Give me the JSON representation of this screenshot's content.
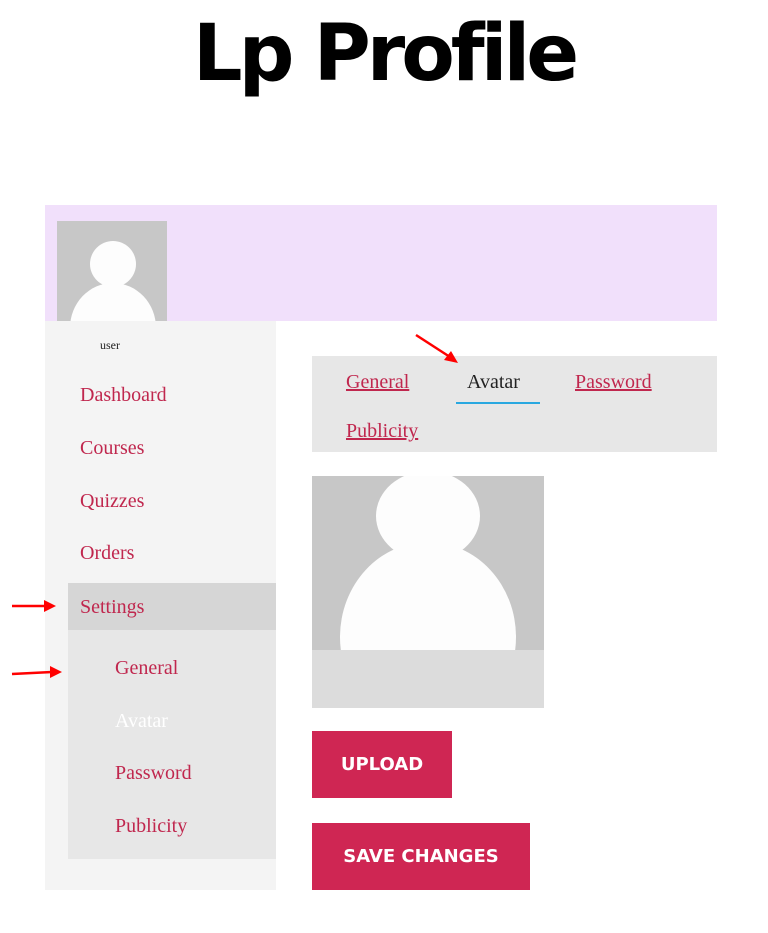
{
  "page": {
    "title": "Lp Profile"
  },
  "profile": {
    "username": "user"
  },
  "sidebar": {
    "items": [
      {
        "label": "Dashboard"
      },
      {
        "label": "Courses"
      },
      {
        "label": "Quizzes"
      },
      {
        "label": "Orders"
      },
      {
        "label": "Settings"
      }
    ],
    "settings_subitems": [
      {
        "label": "General"
      },
      {
        "label": "Avatar"
      },
      {
        "label": "Password"
      },
      {
        "label": "Publicity"
      }
    ]
  },
  "settings_tabs": [
    {
      "label": "General"
    },
    {
      "label": "Avatar",
      "active": true
    },
    {
      "label": "Password"
    },
    {
      "label": "Publicity"
    }
  ],
  "buttons": {
    "upload": "UPLOAD",
    "save": "SAVE CHANGES"
  },
  "colors": {
    "accent": "#cf2653",
    "link": "#c0274e",
    "cover": "#f1e0fb",
    "tab_underline": "#29a8e0",
    "annotation_arrow": "#ff0000"
  },
  "icons": [
    "avatar-placeholder-icon",
    "red-arrow-annotation-icon"
  ]
}
